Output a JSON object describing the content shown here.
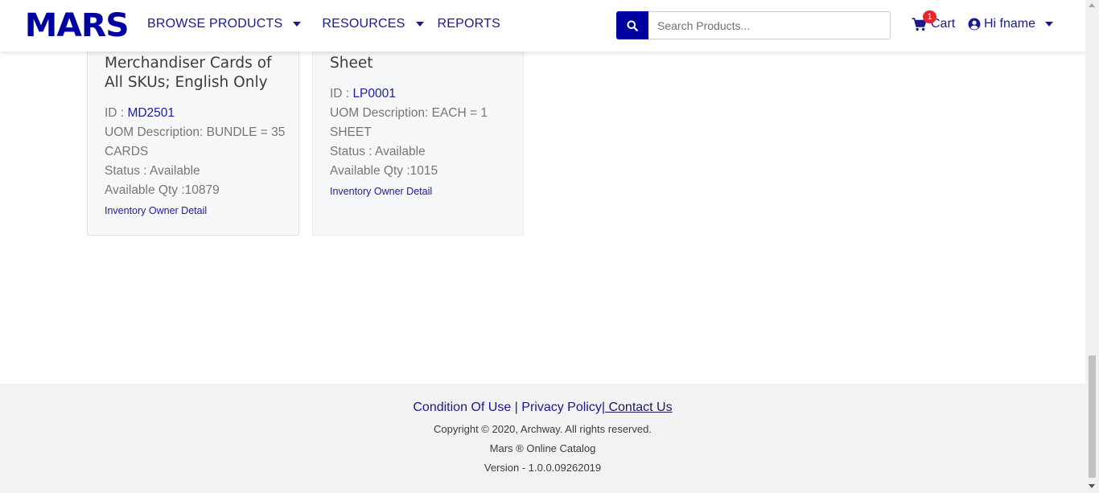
{
  "header": {
    "logo": "MARS",
    "nav": [
      {
        "label": "BROWSE PRODUCTS",
        "has_dropdown": true
      },
      {
        "label": "RESOURCES",
        "has_dropdown": true
      },
      {
        "label": "REPORTS",
        "has_dropdown": false
      }
    ],
    "search": {
      "placeholder": "Search Products...",
      "icon": "search-icon"
    },
    "cart": {
      "label": "Cart",
      "count": "1",
      "icon": "shopping-cart-icon"
    },
    "user": {
      "label": "Hi fname",
      "icon": "user-circle-icon"
    }
  },
  "products": [
    {
      "title": "Merchandiser Cards of All SKUs; English Only",
      "id_label": "ID :",
      "id": "MD2501",
      "uom": "UOM Description: BUNDLE = 35 CARDS",
      "status": "Status : Available",
      "qty": "Available Qty :10879",
      "link": "Inventory Owner Detail"
    },
    {
      "title": "Sheet",
      "id_label": "ID :",
      "id": "LP0001",
      "uom": "UOM Description: EACH = 1 SHEET",
      "status": "Status : Available",
      "qty": "Available Qty :1015",
      "link": "Inventory Owner Detail"
    }
  ],
  "footer": {
    "condition": "Condition Of Use",
    "sep1": "|",
    "privacy": "Privacy Policy",
    "sep2": "|",
    "contact": " Contact Us",
    "copyright": "Copyright © 2020, Archway. All rights reserved.",
    "catalog": "Mars ® Online Catalog",
    "version": "Version - 1.0.0.09262019"
  },
  "colors": {
    "brand": "#0000a0",
    "link": "#1a1a8c",
    "badge": "#e5262e"
  }
}
